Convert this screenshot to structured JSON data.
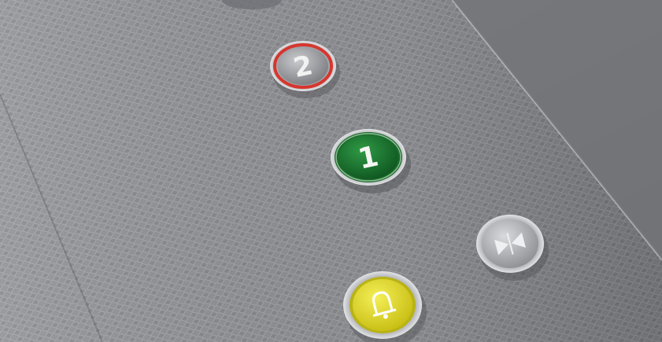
{
  "scene": {
    "subject": "elevator-button-panel",
    "panel_color": "#8e8f92",
    "frame_color": "#6d6e71"
  },
  "buttons": [
    {
      "id": "floor-2",
      "label": "2",
      "bezel_color": "#d6362e",
      "face_color": "#7d8083",
      "icon": null
    },
    {
      "id": "floor-1",
      "label": "1",
      "bezel_color": "#1f7a2c",
      "face_color": "#1e7a32",
      "icon": null
    },
    {
      "id": "door-close",
      "label": "",
      "bezel_color": "#b8babd",
      "face_color": "#a9abaf",
      "icon": "door-close-icon"
    },
    {
      "id": "alarm",
      "label": "",
      "bezel_color": "#a9abaf",
      "face_color": "#e3dc28",
      "icon": "bell-icon"
    }
  ]
}
